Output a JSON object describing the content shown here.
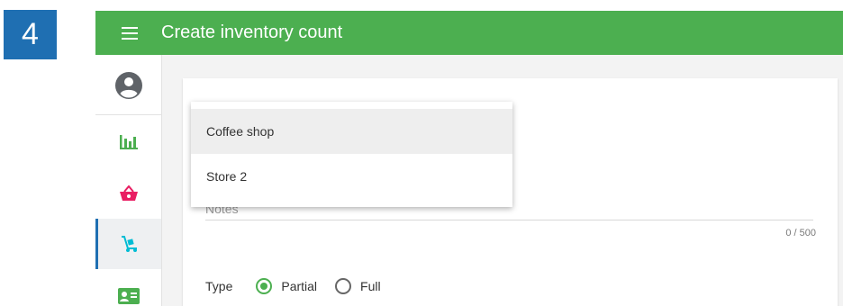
{
  "step": {
    "number": "4"
  },
  "topbar": {
    "title": "Create inventory count",
    "menu_icon": "hamburger-icon",
    "color": "#4caf50"
  },
  "sidebar": {
    "items": [
      {
        "icon": "account-circle-icon",
        "color": "#5f6368"
      },
      {
        "icon": "bar-chart-icon",
        "color": "#4caf50"
      },
      {
        "icon": "shopping-basket-icon",
        "color": "#e91e63"
      },
      {
        "icon": "dolly-icon",
        "color": "#00bcd4",
        "active": true
      },
      {
        "icon": "contact-card-icon",
        "color": "#4caf50"
      }
    ]
  },
  "dropdown": {
    "options": [
      {
        "label": "Coffee shop",
        "selected": true
      },
      {
        "label": "Store 2",
        "selected": false
      }
    ]
  },
  "form": {
    "notes_label": "Notes",
    "notes_counter": "0 / 500",
    "type_label": "Type",
    "type_options": [
      {
        "label": "Partial",
        "checked": true
      },
      {
        "label": "Full",
        "checked": false
      }
    ]
  }
}
